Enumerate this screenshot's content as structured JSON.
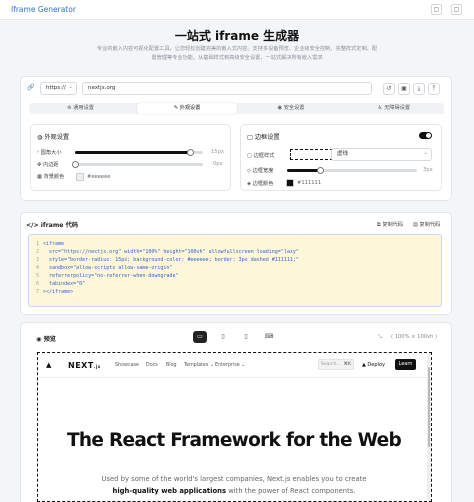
{
  "header": {
    "brand": "Iframe Generator",
    "icon_left": "▢",
    "icon_right": "▢"
  },
  "hero": {
    "title": "一站式 iframe 生成器",
    "description": "专业的嵌入内容可视化配置工具，让您轻松创建完美的嵌入式内容。支持多设备预览、企业级安全控制、完整样式定制、配置管理等专业功能，从基础样式到高级安全设置，一站式解决所有嵌入需求"
  },
  "url_bar": {
    "link_icon": "🔗",
    "protocol": "https://",
    "protocol_chevron": "⌄",
    "url": "nextjs.org",
    "action_icons": [
      "↺",
      "▣",
      "⤓",
      "⤒"
    ]
  },
  "tabs": [
    {
      "icon": "⊚",
      "label": "通用设置"
    },
    {
      "icon": "✎",
      "label": "外观设置"
    },
    {
      "icon": "◉",
      "label": "安全设置"
    },
    {
      "icon": "♿",
      "label": "无障碍设置"
    }
  ],
  "appearance": {
    "icon": "◍",
    "title": "外观设置",
    "radius": {
      "icon": "◜",
      "label": "圆角大小",
      "value": 90,
      "max": 100,
      "unit": "15px"
    },
    "padding": {
      "icon": "✥",
      "label": "内边距",
      "value": 0,
      "max": 100,
      "unit": "0px"
    },
    "bgcolor": {
      "icon": "▦",
      "label": "背景颜色",
      "value": "#eeeeee"
    }
  },
  "border": {
    "icon": "▢",
    "title": "边框设置",
    "enabled": true,
    "style": {
      "icon": "▢",
      "label": "边框样式",
      "value": "虚线",
      "chevron": "⌄"
    },
    "width": {
      "icon": "◇",
      "label": "边框宽度",
      "value": 3,
      "max": 12,
      "unit": "3px"
    },
    "color": {
      "icon": "◈",
      "label": "边框颜色",
      "value": "#111111"
    }
  },
  "code": {
    "icon": "</>",
    "title": "iframe 代码",
    "copy_label": "⧉ 复制代码",
    "copy_code_label": "▤ 复制代码",
    "lines": [
      "<iframe",
      "  src=\"https://nextjs.org\" width=\"100%\" height=\"100vh\" allowfullscreen loading=\"lazy\"",
      "  style=\"border-radius: 15px; background-color: #eeeeee; border: 3px dashed #111111;\"",
      "  sandbox=\"allow-scripts allow-same-origin\"",
      "  referrerpolicy=\"no-referrer-when-downgrade\"",
      "  tabindex=\"0\"",
      "></iframe>"
    ],
    "line_numbers": [
      "1",
      "2",
      "3",
      "4",
      "5",
      "6",
      "7"
    ]
  },
  "preview": {
    "icon": "◉",
    "title": "预览",
    "devices": [
      "▭",
      "▯",
      "▯",
      "⌨"
    ],
    "size_icon": "⤡",
    "size": "( 100% × 100vh )"
  },
  "site": {
    "logo_mark": "▲",
    "logo_text": "NEXT",
    "logo_suffix": ".js",
    "nav": [
      "Showcase",
      "Docs",
      "Blog",
      "Templates ⌄",
      "Enterprise ⌄"
    ],
    "search_placeholder": "Search...",
    "search_shortcut": "⌘K",
    "deploy_label": "▲ Deploy",
    "learn_label": "Learn",
    "headline": "The React Framework for the Web",
    "sub1": "Used by some of the world's largest companies, Next.js enables you to create",
    "sub2_bold": "high-quality web applications",
    "sub2_rest": " with the power of React components.",
    "colors": {
      "dark": "#111111",
      "muted": "#666666"
    }
  },
  "colors": {
    "accent": "#2f6fd6",
    "code_bg": "#fdf6d8",
    "code_text": "#3563c9",
    "border": "#e3e6ea"
  }
}
